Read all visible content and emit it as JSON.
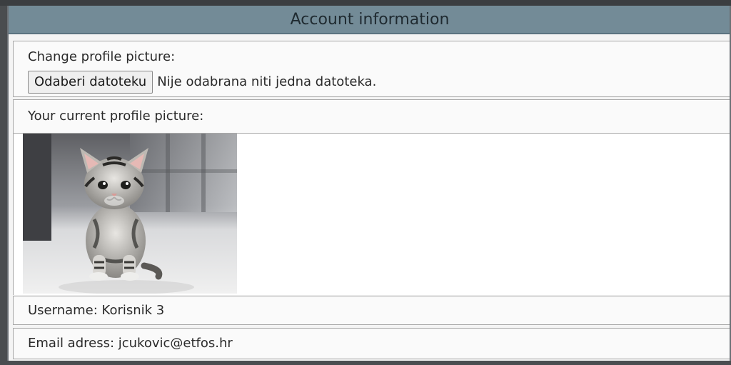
{
  "panel": {
    "title": "Account information"
  },
  "upload": {
    "label": "Change profile picture:",
    "button_label": "Odaberi datoteku",
    "status_text": "Nije odabrana niti jedna datoteka."
  },
  "current_picture": {
    "label": "Your current profile picture:",
    "image_description_icon": "kitten-photo"
  },
  "account": {
    "username_text": "Username: Korisnik 3",
    "email_text": "Email adress: jcukovic@etfos.hr"
  },
  "colors": {
    "header_bg": "#738b97",
    "page_bg": "#4a4d50"
  }
}
